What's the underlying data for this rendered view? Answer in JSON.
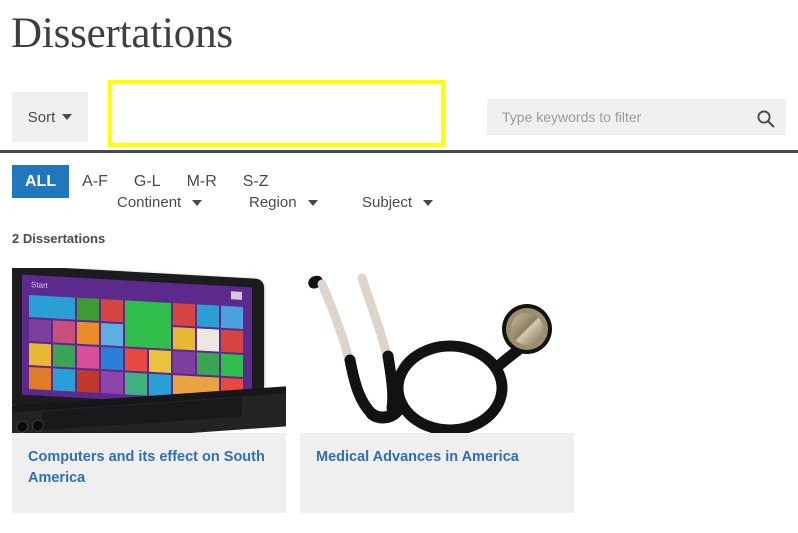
{
  "page": {
    "title": "Dissertations"
  },
  "toolbar": {
    "sort_label": "Sort",
    "facets": [
      {
        "label": "Continent",
        "name": "continent"
      },
      {
        "label": "Region",
        "name": "region"
      },
      {
        "label": "Subject",
        "name": "subject"
      }
    ],
    "highlight_color": "#ffff00",
    "sort_background": "#f0f0f0"
  },
  "search": {
    "placeholder": "Type keywords to filter",
    "value": "",
    "icon": "search-icon",
    "background": "#f0f0f0"
  },
  "alpha_filter": {
    "active": "ALL",
    "active_color": "#2176bd",
    "tabs": [
      {
        "label": "ALL",
        "active": true
      },
      {
        "label": "A-F",
        "active": false
      },
      {
        "label": "G-L",
        "active": false
      },
      {
        "label": "M-R",
        "active": false
      },
      {
        "label": "S-Z",
        "active": false
      }
    ]
  },
  "results": {
    "count_label": "2 Dissertations",
    "items": [
      {
        "title": "Computers and its effect on South America",
        "thumbnail": "laptop-windows-start-screen",
        "link_color": "#2f6fb5"
      },
      {
        "title": "Medical Advances in America",
        "thumbnail": "stethoscope",
        "link_color": "#2f6fb5"
      }
    ]
  }
}
